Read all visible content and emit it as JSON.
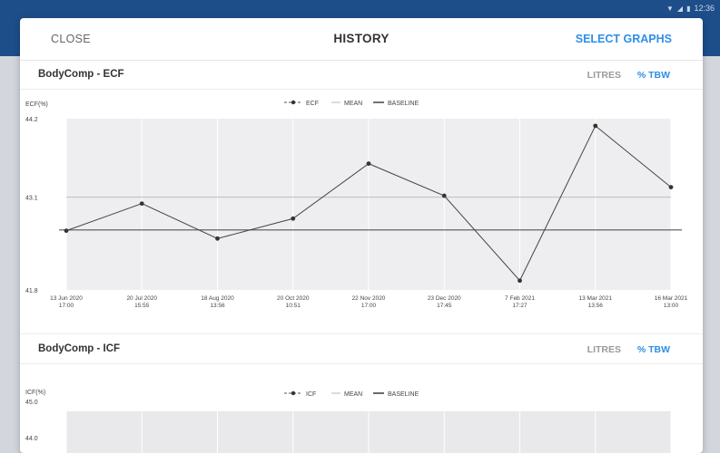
{
  "status": {
    "time": "12:36"
  },
  "header": {
    "close_label": "CLOSE",
    "title": "HISTORY",
    "select_label": "SELECT GRAPHS"
  },
  "colors": {
    "accent": "#2f8fe6",
    "appbar": "#1d4e8a",
    "plot_bg": "#eeeef0"
  },
  "sections": [
    {
      "title": "BodyComp - ECF",
      "unit_litres": "LITRES",
      "unit_tbw": "% TBW",
      "chart_data": {
        "type": "line",
        "ylabel": "ECF(%)",
        "ylim": [
          41.8,
          44.2
        ],
        "y_ticks": [
          "44.2",
          "43.1",
          "41.8"
        ],
        "legend": {
          "series": "ECF",
          "mean": "MEAN",
          "baseline": "BASELINE"
        },
        "x": [
          [
            "13 Jun 2020",
            "17:00"
          ],
          [
            "20 Jul 2020",
            "15:55"
          ],
          [
            "18 Aug 2020",
            "13:56"
          ],
          [
            "20 Oct 2020",
            "10:51"
          ],
          [
            "22 Nov 2020",
            "17:00"
          ],
          [
            "23 Dec 2020",
            "17:45"
          ],
          [
            "7 Feb 2021",
            "17:27"
          ],
          [
            "13 Mar 2021",
            "13:56"
          ],
          [
            "16 Mar 2021",
            "13:00"
          ]
        ],
        "values": [
          42.63,
          43.01,
          42.52,
          42.8,
          43.57,
          43.12,
          41.93,
          44.1,
          43.24
        ],
        "mean": 43.1,
        "baseline": 42.64
      }
    },
    {
      "title": "BodyComp - ICF",
      "unit_litres": "LITRES",
      "unit_tbw": "% TBW",
      "chart_data": {
        "type": "line",
        "ylabel": "ICF(%)",
        "y_ticks": [
          "45.0",
          "44.0"
        ],
        "legend": {
          "series": "ICF",
          "mean": "MEAN",
          "baseline": "BASELINE"
        }
      }
    }
  ]
}
